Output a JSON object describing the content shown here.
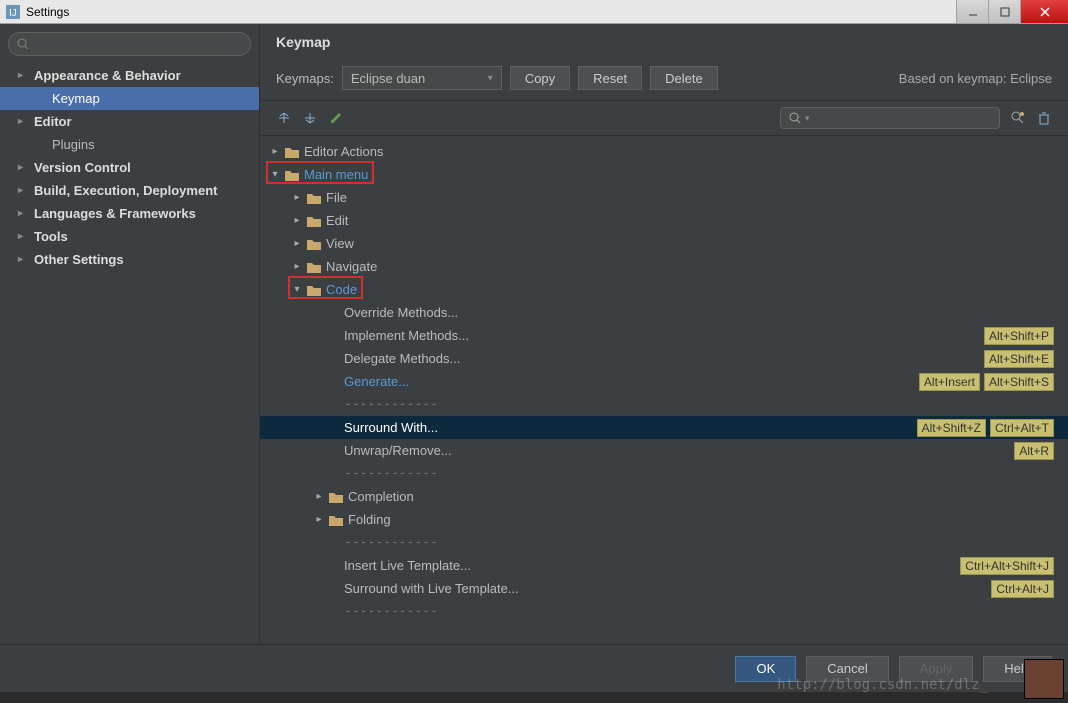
{
  "titlebar": {
    "title": "Settings"
  },
  "sidebar": {
    "items": [
      {
        "label": "Appearance & Behavior",
        "bold": true,
        "arrow": true
      },
      {
        "label": "Keymap",
        "indent": true,
        "selected": true
      },
      {
        "label": "Editor",
        "bold": true,
        "arrow": true
      },
      {
        "label": "Plugins",
        "indent": true
      },
      {
        "label": "Version Control",
        "bold": true,
        "arrow": true
      },
      {
        "label": "Build, Execution, Deployment",
        "bold": true,
        "arrow": true
      },
      {
        "label": "Languages & Frameworks",
        "bold": true,
        "arrow": true
      },
      {
        "label": "Tools",
        "bold": true,
        "arrow": true
      },
      {
        "label": "Other Settings",
        "bold": true,
        "arrow": true
      }
    ]
  },
  "content": {
    "heading": "Keymap",
    "keymaps_label": "Keymaps:",
    "keymaps_value": "Eclipse duan",
    "copy_btn": "Copy",
    "reset_btn": "Reset",
    "delete_btn": "Delete",
    "based_on": "Based on keymap: Eclipse",
    "search_icon": "🔍"
  },
  "tree": [
    {
      "depth": 0,
      "arrow": "▸",
      "folder": true,
      "label": "Editor Actions"
    },
    {
      "depth": 0,
      "arrow": "▾",
      "folder": true,
      "label": "Main menu",
      "blue": true,
      "highlight": 1
    },
    {
      "depth": 1,
      "arrow": "▸",
      "folder": true,
      "label": "File"
    },
    {
      "depth": 1,
      "arrow": "▸",
      "folder": true,
      "label": "Edit"
    },
    {
      "depth": 1,
      "arrow": "▸",
      "folder": true,
      "label": "View"
    },
    {
      "depth": 1,
      "arrow": "▸",
      "folder": true,
      "label": "Navigate"
    },
    {
      "depth": 1,
      "arrow": "▾",
      "folder": true,
      "label": "Code",
      "blue": true,
      "highlight": 2
    },
    {
      "depth": 2,
      "label": "Override Methods..."
    },
    {
      "depth": 2,
      "label": "Implement Methods...",
      "shortcuts": [
        "Alt+Shift+P"
      ]
    },
    {
      "depth": 2,
      "label": "Delegate Methods...",
      "shortcuts": [
        "Alt+Shift+E"
      ]
    },
    {
      "depth": 2,
      "label": "Generate...",
      "blue": true,
      "shortcuts": [
        "Alt+Insert",
        "Alt+Shift+S"
      ]
    },
    {
      "depth": 2,
      "sep": true
    },
    {
      "depth": 2,
      "label": "Surround With...",
      "selected": true,
      "shortcuts": [
        "Alt+Shift+Z",
        "Ctrl+Alt+T"
      ]
    },
    {
      "depth": 2,
      "label": "Unwrap/Remove...",
      "shortcuts": [
        "Alt+R"
      ]
    },
    {
      "depth": 2,
      "sep": true
    },
    {
      "depth": 2,
      "arrow": "▸",
      "folder": true,
      "label": "Completion"
    },
    {
      "depth": 2,
      "arrow": "▸",
      "folder": true,
      "label": "Folding"
    },
    {
      "depth": 2,
      "sep": true
    },
    {
      "depth": 2,
      "label": "Insert Live Template...",
      "shortcuts": [
        "Ctrl+Alt+Shift+J"
      ]
    },
    {
      "depth": 2,
      "label": "Surround with Live Template...",
      "shortcuts": [
        "Ctrl+Alt+J"
      ]
    },
    {
      "depth": 2,
      "sep": true
    }
  ],
  "bottom": {
    "ok": "OK",
    "cancel": "Cancel",
    "apply": "Apply",
    "help": "Help"
  },
  "watermark": "http://blog.csdn.net/dlz_"
}
